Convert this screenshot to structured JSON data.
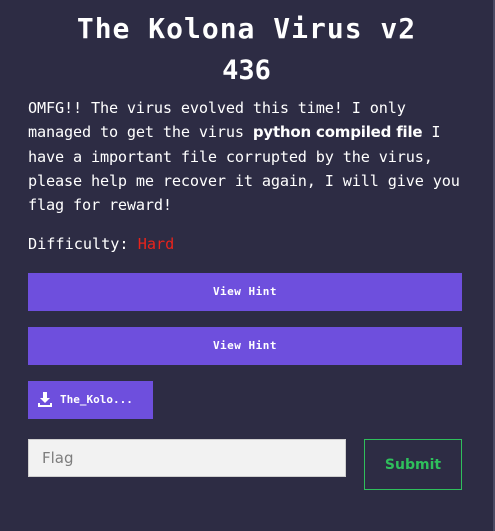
{
  "challenge": {
    "title": "The Kolona Virus v2",
    "points": "436",
    "description": {
      "part1": "OMFG!! The virus evolved this time! I only managed to get the virus ",
      "bold": "python compiled file",
      "part2": " I have a important file corrupted by the virus, please help me recover it again, I will give you flag for reward!"
    },
    "difficulty_label": "Difficulty:",
    "difficulty_value": "Hard",
    "difficulty_color": "#e8231b"
  },
  "hints": [
    {
      "label": "View Hint"
    },
    {
      "label": "View Hint"
    }
  ],
  "file": {
    "label": "The_Kolo...",
    "icon": "download-icon"
  },
  "flag_form": {
    "placeholder": "Flag",
    "value": "",
    "submit_label": "Submit"
  },
  "colors": {
    "background": "#2d2c44",
    "accent": "#6e4fdd",
    "submit": "#2fbf5c"
  }
}
